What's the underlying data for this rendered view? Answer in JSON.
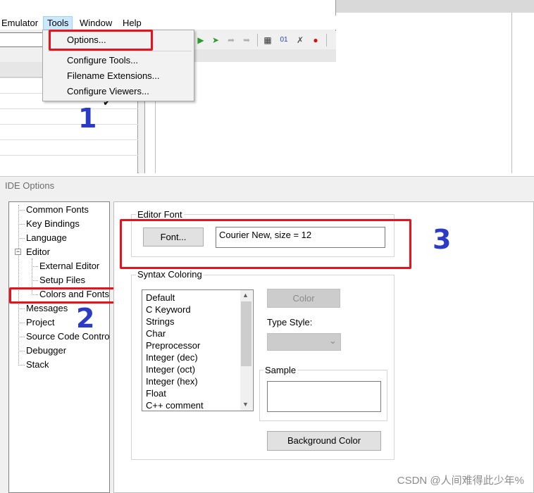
{
  "menubar": {
    "items": [
      "Emulator",
      "Tools",
      "Window",
      "Help"
    ]
  },
  "tools_menu": {
    "items": [
      "Options...",
      "Configure Tools...",
      "Filename Extensions...",
      "Configure Viewers..."
    ]
  },
  "dialog": {
    "title": "IDE Options",
    "tree": {
      "items": [
        "Common Fonts",
        "Key Bindings",
        "Language",
        "Editor",
        "External Editor",
        "Setup Files",
        "Colors and Fonts",
        "Messages",
        "Project",
        "Source Code Contro",
        "Debugger",
        "Stack"
      ],
      "expand_glyph": "−"
    },
    "editor_font": {
      "group_title": "Editor Font",
      "font_button": "Font...",
      "font_value": "Courier New, size = 12"
    },
    "syntax_coloring": {
      "group_title": "Syntax Coloring",
      "items": [
        "Default",
        "C Keyword",
        "Strings",
        "Char",
        "Preprocessor",
        "Integer (dec)",
        "Integer (oct)",
        "Integer (hex)",
        "Float",
        "C++ comment"
      ],
      "color_button": "Color",
      "type_style_label": "Type Style:",
      "sample_title": "Sample",
      "background_color_button": "Background Color"
    }
  },
  "annotations": {
    "step1": "1",
    "step2": "2",
    "step3": "3",
    "color": "#e8121d",
    "number_color": "#2c3bc7"
  },
  "watermark": "CSDN @人间难得此少年%",
  "glyphs": {
    "checkmark": "✔",
    "scroll_up": "▲",
    "scroll_down": "▼",
    "select_arrow": "⌄"
  }
}
